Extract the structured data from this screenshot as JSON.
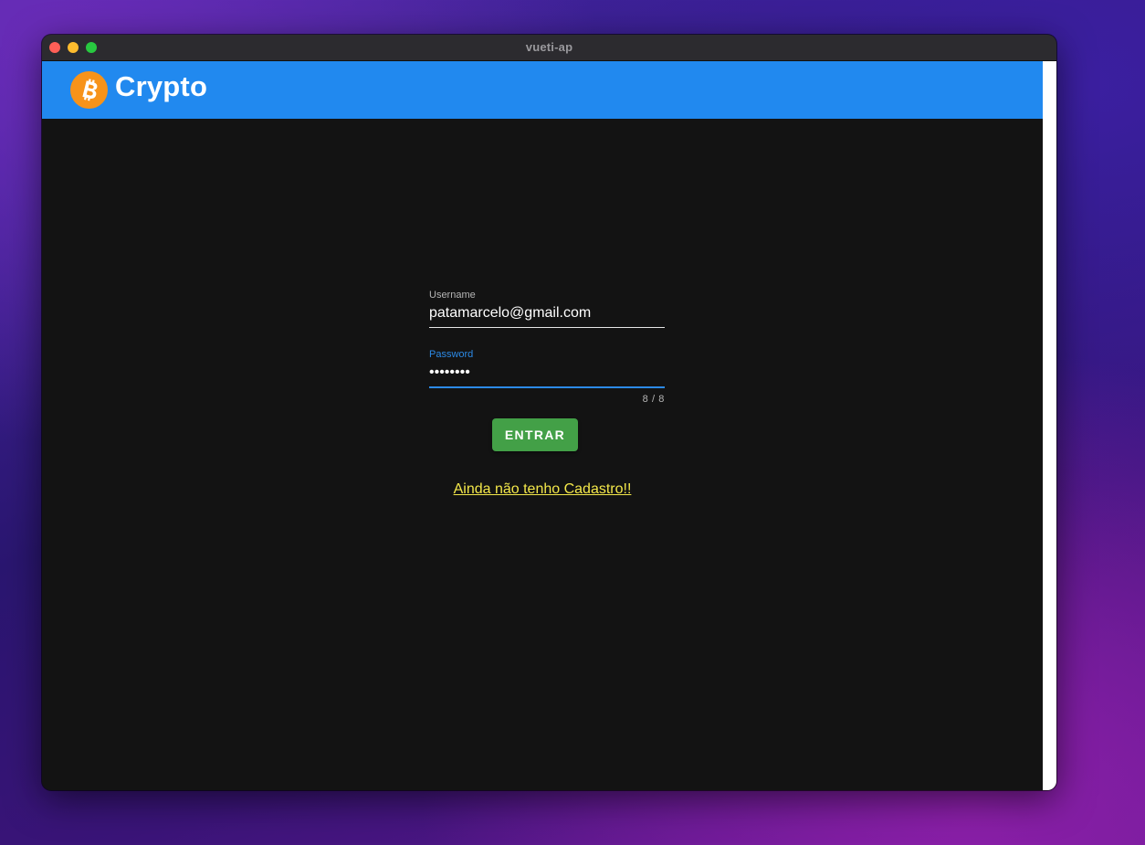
{
  "window": {
    "title": "vueti-ap"
  },
  "appbar": {
    "brand": "Crypto",
    "logo_icon": "bitcoin-icon",
    "color": "#2189ef"
  },
  "login": {
    "username": {
      "label": "Username",
      "value": "patamarcelo@gmail.com"
    },
    "password": {
      "label": "Password",
      "value": "12345678",
      "counter": "8 / 8"
    },
    "submit_label": "ENTRAR",
    "register_link": "Ainda não tenho Cadastro!!"
  },
  "colors": {
    "accent": "#2c8ae6",
    "button": "#43a047",
    "link": "#f4e84a",
    "background": "#131313"
  }
}
